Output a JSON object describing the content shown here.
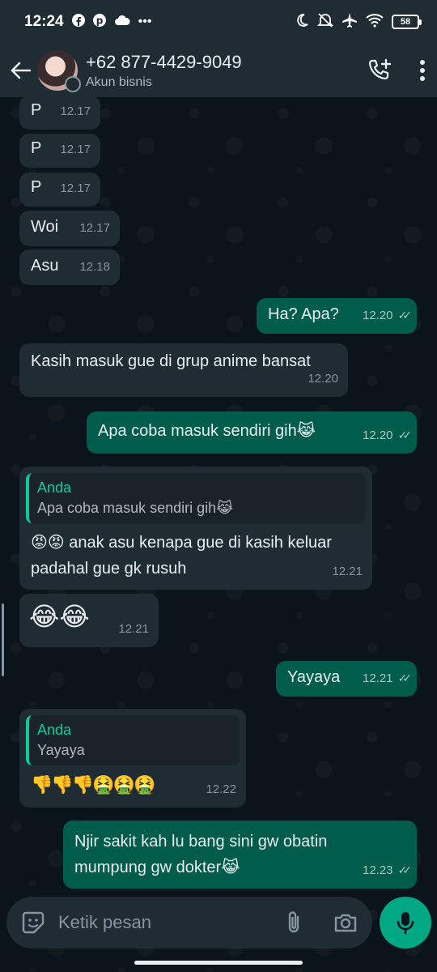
{
  "status_bar": {
    "time": "12:24",
    "battery": "58",
    "left_icons": [
      "facebook-icon",
      "pinterest-icon",
      "cloud-icon",
      "more-dots-icon"
    ],
    "right_icons": [
      "moon-icon",
      "mute-icon",
      "airplane-icon",
      "wifi-icon",
      "battery-icon"
    ]
  },
  "header": {
    "contact_name": "+62 877-4429-9049",
    "subtitle": "Akun bisnis"
  },
  "messages": [
    {
      "dir": "in",
      "text": "P",
      "time": "12.17"
    },
    {
      "dir": "in",
      "text": "P",
      "time": "12.17"
    },
    {
      "dir": "in",
      "text": "P",
      "time": "12.17"
    },
    {
      "dir": "in",
      "text": "Woi",
      "time": "12.17"
    },
    {
      "dir": "in",
      "text": "Asu",
      "time": "12.18"
    },
    {
      "dir": "out",
      "text": "Ha? Apa?",
      "time": "12.20"
    },
    {
      "dir": "in",
      "text": "Kasih masuk gue di grup anime bansat",
      "time": "12.20"
    },
    {
      "dir": "out",
      "text": "Apa coba masuk sendiri gih😹",
      "time": "12.20"
    },
    {
      "dir": "in",
      "quote_author": "Anda",
      "quote_text": "Apa coba masuk sendiri gih😹",
      "text": "😡😡 anak asu kenapa gue di kasih keluar padahal gue gk rusuh",
      "time": "12.21"
    },
    {
      "dir": "in",
      "text": "😂😂",
      "time": "12.21"
    },
    {
      "dir": "out",
      "text": "Yayaya",
      "time": "12.21"
    },
    {
      "dir": "in",
      "quote_author": "Anda",
      "quote_text": "Yayaya",
      "text": "👎👎👎🤮🤮🤮",
      "time": "12.22"
    },
    {
      "dir": "out",
      "text": "Njir sakit kah lu bang sini gw obatin mumpung gw dokter😹",
      "time": "12.23"
    }
  ],
  "composer": {
    "placeholder": "Ketik pesan"
  },
  "colors": {
    "background": "#0b141a",
    "header": "#1f2c34",
    "incoming_bubble": "#202c33",
    "outgoing_bubble": "#005c4b",
    "accent": "#00a884"
  }
}
